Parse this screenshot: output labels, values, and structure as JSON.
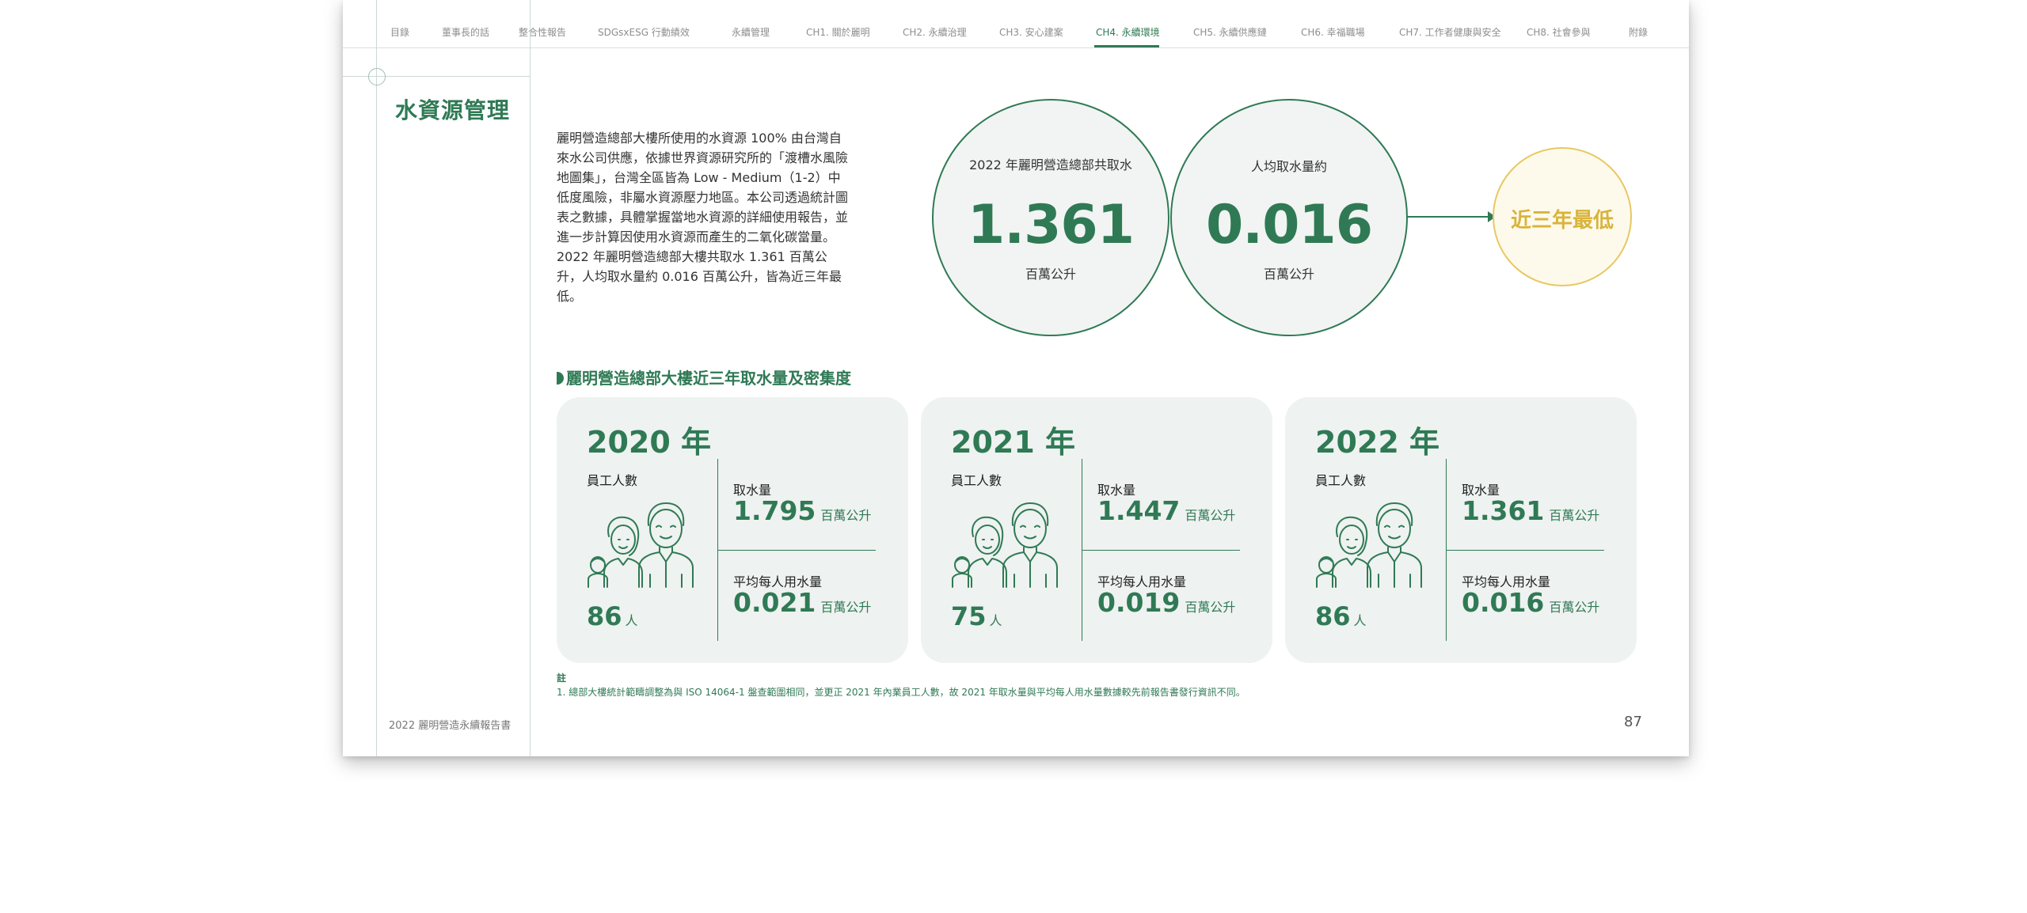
{
  "nav": {
    "items": [
      {
        "label": "目錄",
        "active": false
      },
      {
        "label": "董事長的話",
        "active": false
      },
      {
        "label": "整合性報告",
        "active": false
      },
      {
        "label": "SDGsxESG 行動績效",
        "active": false
      },
      {
        "label": "永續管理",
        "active": false
      },
      {
        "label": "CH1. 關於麗明",
        "active": false
      },
      {
        "label": "CH2. 永續治理",
        "active": false
      },
      {
        "label": "CH3. 安心建案",
        "active": false
      },
      {
        "label": "CH4. 永續環境",
        "active": true
      },
      {
        "label": "CH5. 永續供應鏈",
        "active": false
      },
      {
        "label": "CH6. 幸福職場",
        "active": false
      },
      {
        "label": "CH7. 工作者健康與安全",
        "active": false
      },
      {
        "label": "CH8. 社會參與",
        "active": false
      },
      {
        "label": "附錄",
        "active": false
      }
    ]
  },
  "section_title": "水資源管理",
  "intro": "麗明營造總部大樓所使用的水資源 100% 由台灣自來水公司供應，依據世界資源研究所的「渡槽水風險地圖集」，台灣全區皆為 Low - Medium（1-2）中低度風險，非屬水資源壓力地區。本公司透過統計圖表之數據，具體掌握當地水資源的詳細使用報告，並進一步計算因使用水資源而產生的二氧化碳當量。2022 年麗明營造總部大樓共取水 1.361 百萬公升，人均取水量約 0.016 百萬公升，皆為近三年最低。",
  "highlights": [
    {
      "label": "2022 年麗明營造總部共取水",
      "value": "1.361",
      "unit": "百萬公升"
    },
    {
      "label": "人均取水量約",
      "value": "0.016",
      "unit": "百萬公升"
    }
  ],
  "highlight_note": "近三年最低",
  "sub_heading": "麗明營造總部大樓近三年取水量及密集度",
  "cards": [
    {
      "year": "2020 年",
      "emp_label": "員工人數",
      "emp_count": "86",
      "emp_unit": "人",
      "water_label": "取水量",
      "water_value": "1.795",
      "water_unit": "百萬公升",
      "avg_label": "平均每人用水量",
      "avg_value": "0.021",
      "avg_unit": "百萬公升"
    },
    {
      "year": "2021 年",
      "emp_label": "員工人數",
      "emp_count": "75",
      "emp_unit": "人",
      "water_label": "取水量",
      "water_value": "1.447",
      "water_unit": "百萬公升",
      "avg_label": "平均每人用水量",
      "avg_value": "0.019",
      "avg_unit": "百萬公升"
    },
    {
      "year": "2022 年",
      "emp_label": "員工人數",
      "emp_count": "86",
      "emp_unit": "人",
      "water_label": "取水量",
      "water_value": "1.361",
      "water_unit": "百萬公升",
      "avg_label": "平均每人用水量",
      "avg_value": "0.016",
      "avg_unit": "百萬公升"
    }
  ],
  "note_label": "註",
  "note_text": "1. 總部大樓統計範疇調整為與 ISO 14064-1 盤查範圍相同，並更正 2021 年內業員工人數，故 2021 年取水量與平均每人用水量數據較先前報告書發行資訊不同。",
  "footer": "2022 麗明營造永續報告書",
  "page_number": "87",
  "colors": {
    "brand_green": "#2f7a55",
    "gold": "#d9b33b",
    "card_bg": "#eef2f0"
  }
}
